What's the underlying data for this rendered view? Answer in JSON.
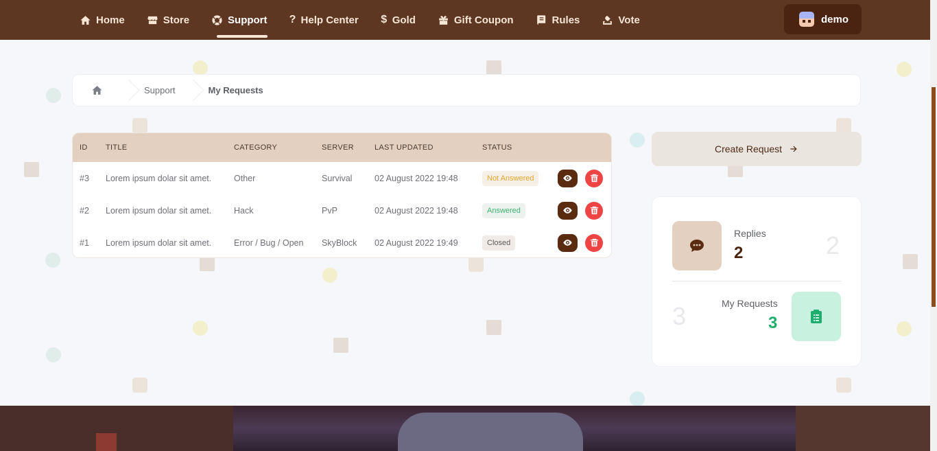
{
  "nav": {
    "items": [
      {
        "label": "Home",
        "icon": "home-icon"
      },
      {
        "label": "Store",
        "icon": "store-icon"
      },
      {
        "label": "Support",
        "icon": "lifebuoy-icon",
        "active": true
      },
      {
        "label": "Help Center",
        "icon": "question-icon"
      },
      {
        "label": "Gold",
        "icon": "dollar-icon"
      },
      {
        "label": "Gift Coupon",
        "icon": "gift-icon"
      },
      {
        "label": "Rules",
        "icon": "book-icon"
      },
      {
        "label": "Vote",
        "icon": "vote-icon"
      }
    ],
    "user": {
      "name": "demo"
    }
  },
  "breadcrumb": {
    "items": [
      "Support",
      "My Requests"
    ]
  },
  "table": {
    "headers": [
      "ID",
      "TITLE",
      "CATEGORY",
      "SERVER",
      "LAST UPDATED",
      "STATUS"
    ],
    "rows": [
      {
        "id": "#3",
        "title": "Lorem ipsum dolar sit amet.",
        "category": "Other",
        "server": "Survival",
        "updated": "02 August 2022 19:48",
        "status": "Not Answered"
      },
      {
        "id": "#2",
        "title": "Lorem ipsum dolar sit amet.",
        "category": "Hack",
        "server": "PvP",
        "updated": "02 August 2022 19:48",
        "status": "Answered"
      },
      {
        "id": "#1",
        "title": "Lorem ipsum dolar sit amet.",
        "category": "Error / Bug / Open",
        "server": "SkyBlock",
        "updated": "02 August 2022 19:49",
        "status": "Closed"
      }
    ]
  },
  "create_request": {
    "label": "Create Request"
  },
  "stats": {
    "replies": {
      "label": "Replies",
      "value": "2",
      "ghost": "2"
    },
    "my_requests": {
      "label": "My Requests",
      "value": "3",
      "ghost": "3"
    }
  },
  "colors": {
    "nav_bg": "#5e3722",
    "accent_brown": "#5a2a11",
    "danger": "#ef4444",
    "success": "#1fae6e",
    "table_header": "#e3d0c0"
  }
}
